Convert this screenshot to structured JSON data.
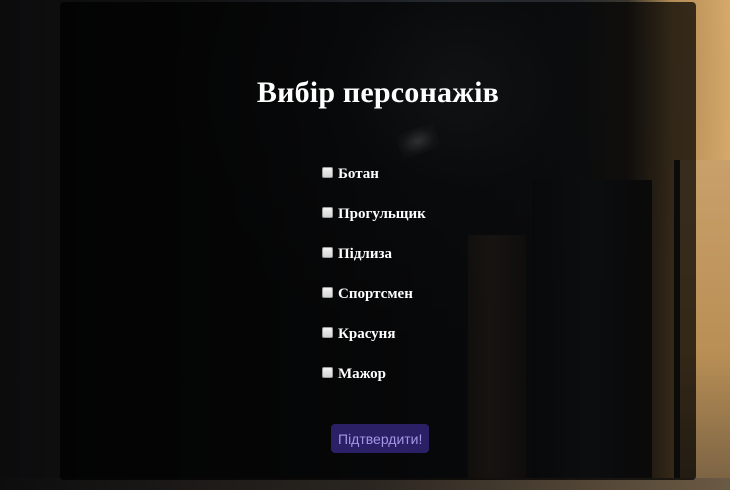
{
  "page": {
    "title": "Вибір персонажів"
  },
  "characters": [
    {
      "label": "Ботан",
      "checked": false
    },
    {
      "label": "Прогульщик",
      "checked": false
    },
    {
      "label": "Підлиза",
      "checked": false
    },
    {
      "label": "Спортсмен",
      "checked": false
    },
    {
      "label": "Красуня",
      "checked": false
    },
    {
      "label": "Мажор",
      "checked": false
    }
  ],
  "actions": {
    "confirm_label": "Підтвердити!"
  },
  "colors": {
    "panel_background": "#000000",
    "text": "#ffffff",
    "button_background": "#2b1f66",
    "button_text": "#a596e6"
  }
}
